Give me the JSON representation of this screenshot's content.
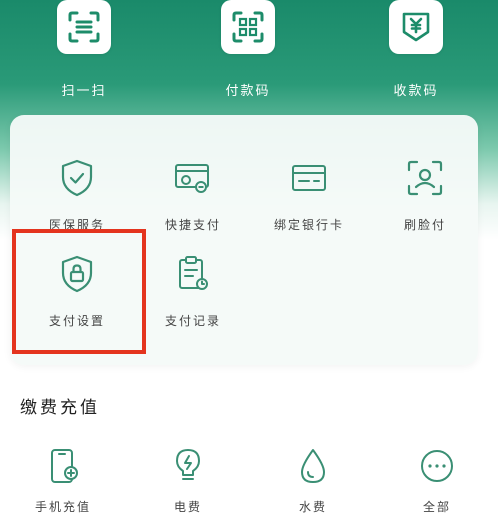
{
  "colors": {
    "accent": "#1d8c6a",
    "highlight": "#e4341e",
    "icon_stroke": "#3a8f74"
  },
  "top_actions": [
    {
      "label": "扫一扫",
      "icon": "scan-icon"
    },
    {
      "label": "付款码",
      "icon": "qr-code-icon"
    },
    {
      "label": "收款码",
      "icon": "yen-receive-icon"
    }
  ],
  "services": [
    {
      "label": "医保服务",
      "icon": "shield-check-icon"
    },
    {
      "label": "快捷支付",
      "icon": "card-pay-icon"
    },
    {
      "label": "绑定银行卡",
      "icon": "bank-card-icon"
    },
    {
      "label": "刷脸付",
      "icon": "face-scan-icon"
    },
    {
      "label": "支付设置",
      "icon": "shield-lock-icon"
    },
    {
      "label": "支付记录",
      "icon": "receipt-icon"
    }
  ],
  "bills_section": {
    "title": "缴费充值",
    "items": [
      {
        "label": "手机充值",
        "icon": "phone-recharge-icon"
      },
      {
        "label": "电费",
        "icon": "bulb-icon"
      },
      {
        "label": "水费",
        "icon": "water-drop-icon"
      },
      {
        "label": "全部",
        "icon": "more-dots-icon"
      }
    ]
  }
}
